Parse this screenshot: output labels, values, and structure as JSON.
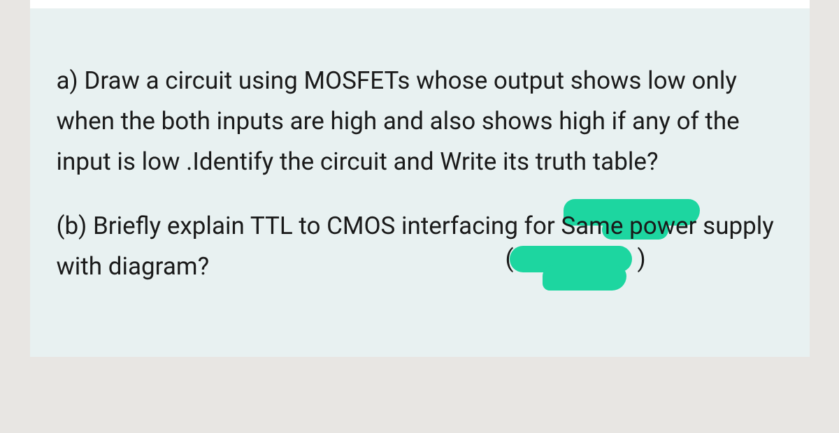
{
  "questions": {
    "a": "a) Draw a circuit using MOSFETs whose output shows low only when the both inputs are high and also shows high if any of the input is low .Identify the circuit and Write its truth table?",
    "b": "(b) Briefly explain TTL to CMOS interfacing for Same power supply with diagram?"
  }
}
